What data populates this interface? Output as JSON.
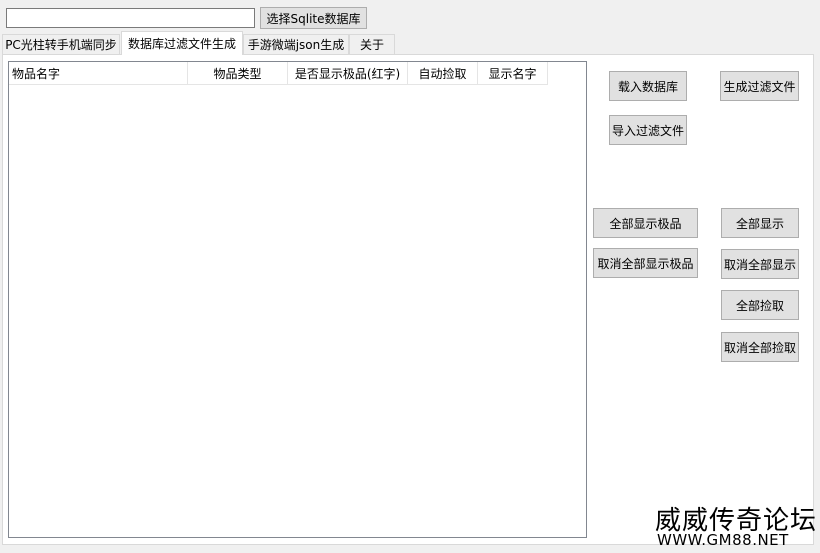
{
  "toolbar": {
    "path_value": "",
    "select_db_label": "选择Sqlite数据库"
  },
  "tabs": [
    {
      "label": "PC光柱转手机端同步",
      "active": false
    },
    {
      "label": "数据库过滤文件生成",
      "active": true
    },
    {
      "label": "手游微端json生成",
      "active": false
    },
    {
      "label": "关于",
      "active": false
    }
  ],
  "table": {
    "columns": [
      "物品名字",
      "物品类型",
      "是否显示极品(红字)",
      "自动捡取",
      "显示名字"
    ],
    "rows": []
  },
  "buttons": {
    "load_db": "载入数据库",
    "gen_filter": "生成过滤文件",
    "import_filter": "导入过滤文件",
    "show_all_extreme": "全部显示极品",
    "show_all": "全部显示",
    "cancel_all_extreme": "取消全部显示极品",
    "cancel_all_show": "取消全部显示",
    "pick_all": "全部捡取",
    "cancel_all_pick": "取消全部捡取"
  },
  "watermark": {
    "title": "威威传奇论坛",
    "url": "WWW.GM88.NET"
  }
}
